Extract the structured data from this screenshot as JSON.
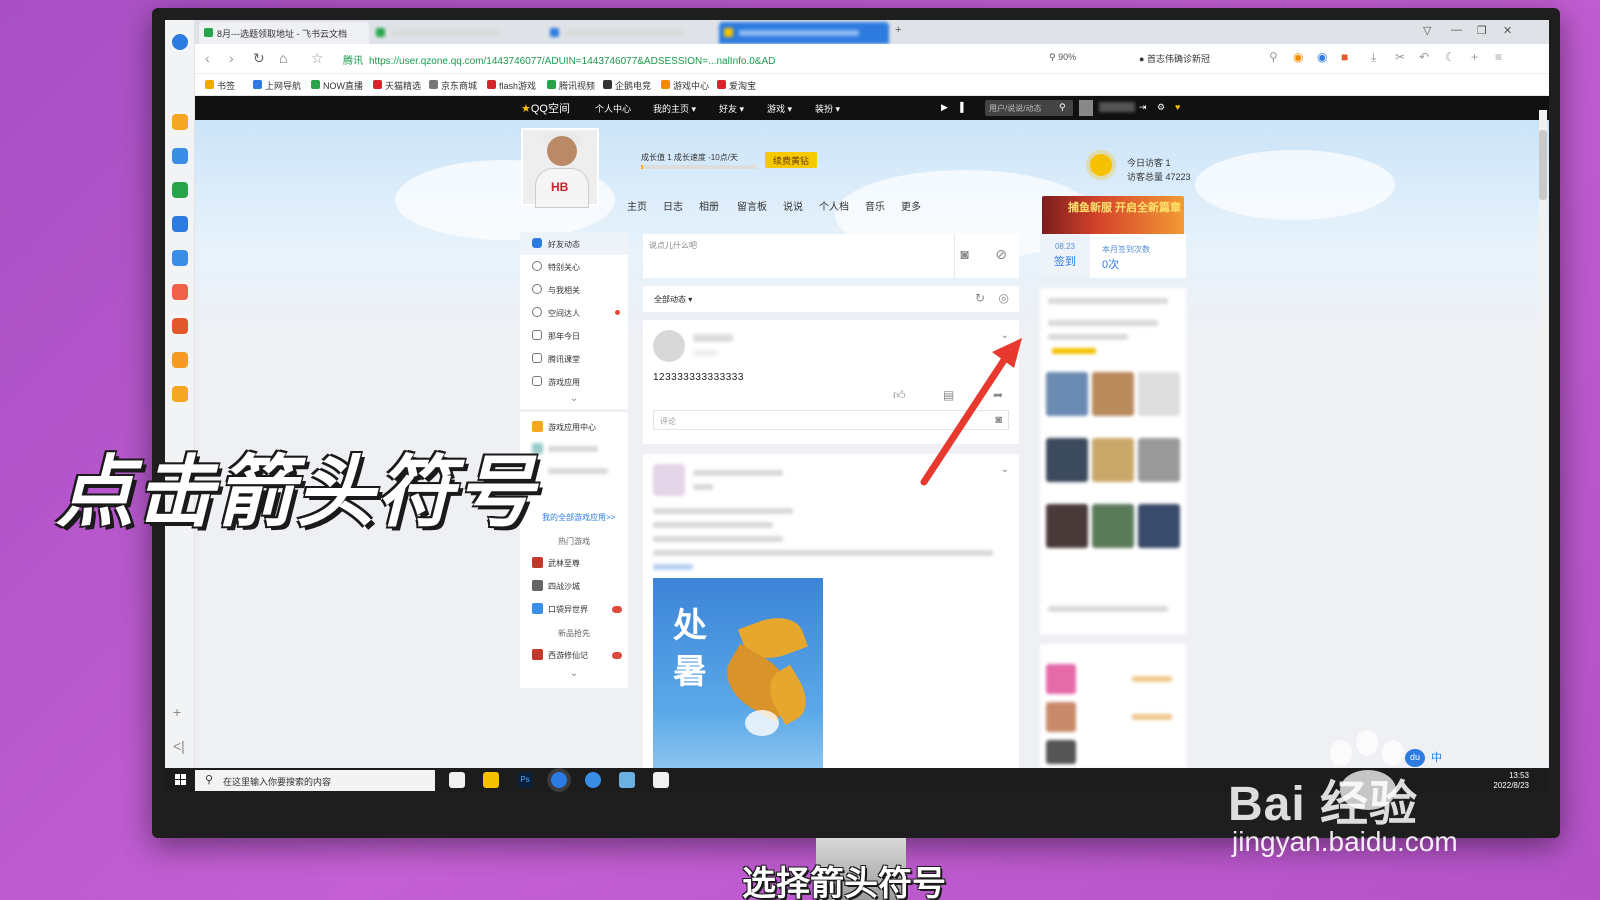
{
  "browser": {
    "tabs": [
      {
        "label": "8月---选题领取地址 - 飞书云文档"
      },
      {
        "label": ""
      },
      {
        "label": ""
      },
      {
        "label": ""
      }
    ],
    "url_host": "腾讯",
    "url": "https://user.qzone.qq.com/1443746077/ADUIN=1443746077&ADSESSION=...nalInfo.0&AD",
    "zoom": "90%",
    "search_promo": "首志伟确诊新冠",
    "bookmarks": [
      {
        "label": "书签",
        "color": "#f2a900"
      },
      {
        "label": "上网导航",
        "color": "#2d7be0"
      },
      {
        "label": "NOW直播",
        "color": "#27a44a"
      },
      {
        "label": "天猫精选",
        "color": "#d4262c"
      },
      {
        "label": "京东商城",
        "color": "#777777"
      },
      {
        "label": "flash游戏",
        "color": "#d4262c"
      },
      {
        "label": "腾讯视频",
        "color": "#27a44a"
      },
      {
        "label": "企鹅电竞",
        "color": "#333333"
      },
      {
        "label": "游戏中心",
        "color": "#f28c00"
      },
      {
        "label": "爱淘宝",
        "color": "#d4262c"
      }
    ]
  },
  "qzone_nav": {
    "logo": "QQ空间",
    "items": [
      "个人中心",
      "我的主页 ▾",
      "好友 ▾",
      "游戏 ▾",
      "装扮 ▾"
    ],
    "search_placeholder": "用户/说说/动态"
  },
  "profile": {
    "avatar_text": "HB",
    "growth_label": "成长值 1   成长速度 -10点/天",
    "growth_fraction": 0.02,
    "vip_button": "续费黄钻",
    "visitor_today": "今日访客 1",
    "visitor_total": "访客总量 47223",
    "page_nav": [
      "主页",
      "日志",
      "相册",
      "留言板",
      "说说",
      "个人档",
      "音乐",
      "更多"
    ]
  },
  "sidebar": {
    "items": [
      {
        "label": "好友动态",
        "active": true
      },
      {
        "label": "特别关心"
      },
      {
        "label": "与我相关"
      },
      {
        "label": "空间达人",
        "dot": true
      },
      {
        "label": "那年今日"
      },
      {
        "label": "腾讯课堂"
      },
      {
        "label": "游戏应用"
      }
    ],
    "game_center": "游戏应用中心",
    "my_games_link": "我的全部游戏应用>>",
    "hot_games_title": "热门游戏",
    "games": [
      "武林至尊",
      "四战沙城",
      "口袋异世界"
    ],
    "new_title": "新品抢先",
    "new_games": [
      "西游修仙记"
    ]
  },
  "feed": {
    "composer_placeholder": "说点儿什么吧",
    "filter_label": "全部动态 ▾",
    "post_text": "123333333333333",
    "comment_placeholder": "评论",
    "poster_line1": "处",
    "poster_line2": "暑"
  },
  "right": {
    "banner_text": "捕鱼新服 开启全新篇章",
    "sign_date": "08.23",
    "sign_label": "签到",
    "month_title": "本月签到次数",
    "month_count": "0次"
  },
  "taskbar": {
    "search_placeholder": "在这里输入你要搜索的内容",
    "time": "13:53",
    "date": "2022/8/23",
    "ime_label": "中"
  },
  "overlay": {
    "big_caption": "点击箭头符号",
    "sub_caption": "选择箭头符号",
    "watermark_logo": "Bai 经验",
    "watermark_url": "jingyan.baidu.com"
  }
}
